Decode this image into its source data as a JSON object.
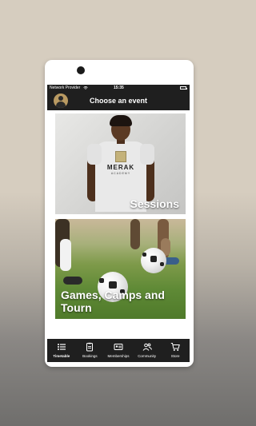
{
  "status_bar": {
    "carrier": "Network Provider",
    "time": "15:35"
  },
  "header": {
    "title": "Choose an event"
  },
  "cards": [
    {
      "label": "Sessions"
    },
    {
      "label": "Games, Camps and Tourn"
    }
  ],
  "card_art": {
    "brand": "MERAK",
    "brand_sub": "ACADEMY"
  },
  "tabs": [
    {
      "label": "Timetable",
      "icon": "list-icon",
      "active": true
    },
    {
      "label": "Bookings",
      "icon": "clipboard-icon",
      "active": false
    },
    {
      "label": "Memberships",
      "icon": "id-card-icon",
      "active": false
    },
    {
      "label": "Community",
      "icon": "people-icon",
      "active": false
    },
    {
      "label": "Store",
      "icon": "cart-icon",
      "active": false
    }
  ],
  "colors": {
    "bar_background": "#1f1f1f",
    "avatar_gold": "#b99a62",
    "background_top": "#d6cdbf",
    "background_bottom": "#6f6e6c"
  }
}
